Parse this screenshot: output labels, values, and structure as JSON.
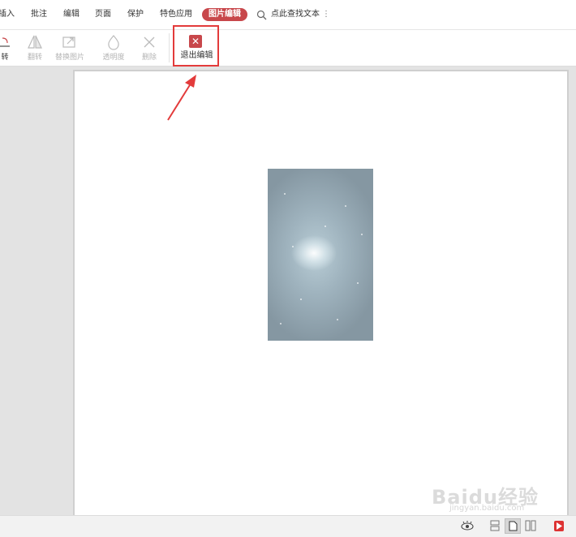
{
  "menu": {
    "items": [
      "插入",
      "批注",
      "编辑",
      "页面",
      "保护",
      "特色应用"
    ],
    "active": "图片编辑",
    "search_text": "点此查找文本",
    "more": "⋮"
  },
  "ribbon": {
    "tools": [
      "转",
      "翻转",
      "替换图片",
      "透明度",
      "删除"
    ],
    "exit_label": "退出编辑",
    "exit_icon": "close-icon"
  },
  "watermark": {
    "text": "Baidu经验",
    "sub": "jingyan.baidu.com"
  },
  "colors": {
    "accent": "#c8474b",
    "highlight": "#e33b3b",
    "arrow": "#e33b3b"
  }
}
